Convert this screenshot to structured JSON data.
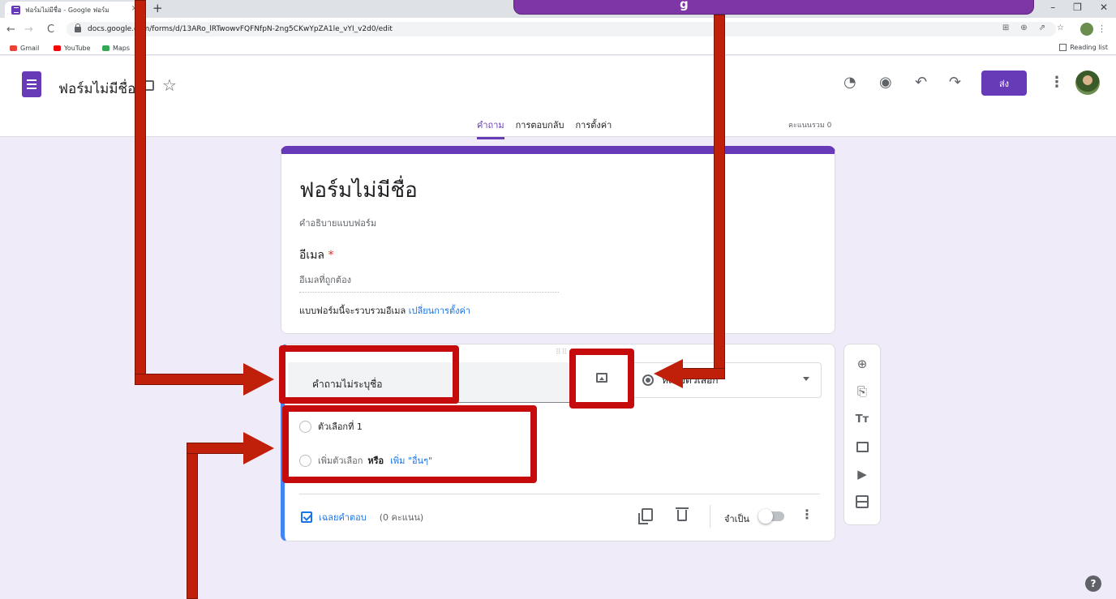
{
  "browser": {
    "tab_title": "ฟอร์มไม่มีชื่อ - Google ฟอร์ม",
    "tab_close": "×",
    "new_tab": "+",
    "minimize": "–",
    "restore": "❐",
    "close": "✕",
    "back": "←",
    "forward": "→",
    "reload": "C",
    "url": "docs.google.com/forms/d/13ARo_lRTwowvFQFNfpN-2ng5CKwYpZA1le_vYI_v2d0/edit",
    "bookmarks": [
      {
        "label": "Gmail",
        "color": "#ea4335"
      },
      {
        "label": "YouTube",
        "color": "#ff0000"
      },
      {
        "label": "Maps",
        "color": "#34a853"
      }
    ],
    "reading_list": "Reading list"
  },
  "header": {
    "title": "ฟอร์มไม่มีชื่อ",
    "send_label": "ส่ง",
    "tabs": {
      "questions": "คำถาม",
      "responses": "การตอบกลับ",
      "settings": "การตั้งค่า"
    },
    "total_score": "คะแนนรวม 0"
  },
  "form": {
    "title": "ฟอร์มไม่มีชื่อ",
    "description": "คำอธิบายแบบฟอร์ม",
    "email_label": "อีเมล",
    "required_mark": "*",
    "email_placeholder": "อีเมลที่ถูกต้อง",
    "collect_note": "แบบฟอร์มนี้จะรวบรวมอีเมล",
    "change_settings": "เปลี่ยนการตั้งค่า"
  },
  "question": {
    "placeholder": "คำถามไม่ระบุชื่อ",
    "type": "หลายตัวเลือก",
    "option1": "ตัวเลือกที่ 1",
    "add_option": "เพิ่มตัวเลือก",
    "or": "หรือ",
    "add_other": "เพิ่ม \"อื่นๆ\"",
    "answer_key": "เฉลยคำตอบ",
    "points": "(0 คะแนน)",
    "required": "จำเป็น"
  },
  "annotation": {
    "callout_char": "g"
  },
  "colors": {
    "accent": "#673ab7",
    "background": "#f0ebf8",
    "annotation_red": "#c0200a",
    "link_blue": "#1a73e8"
  }
}
